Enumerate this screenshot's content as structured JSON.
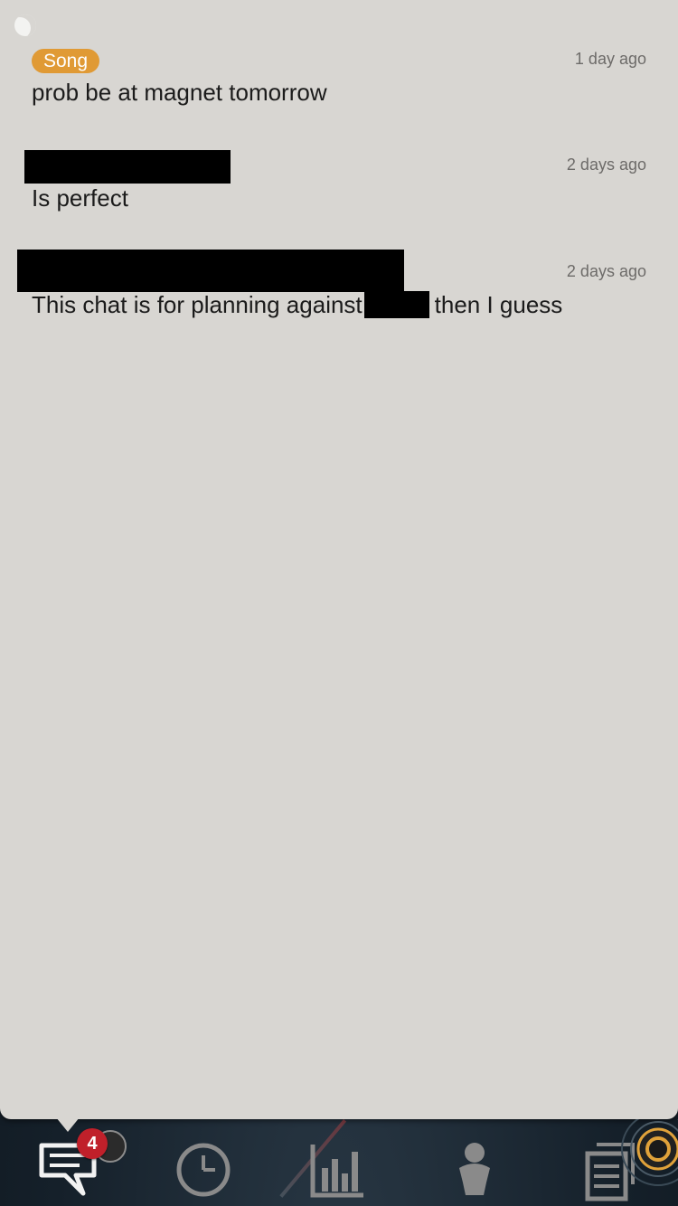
{
  "messages": [
    {
      "sender_tag": "Song",
      "time": "1 day ago",
      "text": "prob be at magnet tomorrow"
    },
    {
      "time": "2 days ago",
      "text": "Is perfect"
    },
    {
      "time": "2 days ago",
      "text_before": "This chat is for planning against",
      "text_after": "then I guess"
    }
  ],
  "nav": {
    "chat_badge": "4",
    "items": [
      {
        "icon": "chat-icon",
        "active": true
      },
      {
        "icon": "clock-icon",
        "active": false
      },
      {
        "icon": "bar-chart-icon",
        "active": false
      },
      {
        "icon": "person-icon",
        "active": false
      },
      {
        "icon": "document-icon",
        "active": false
      },
      {
        "icon": "settings-dial-icon",
        "active": false
      }
    ]
  },
  "colors": {
    "panel": "#d8d6d2",
    "sender_tag": "#e09a35",
    "badge": "#c0202a",
    "nav_icon": "#9a9a9a",
    "accent_gold": "#e0a23a"
  }
}
